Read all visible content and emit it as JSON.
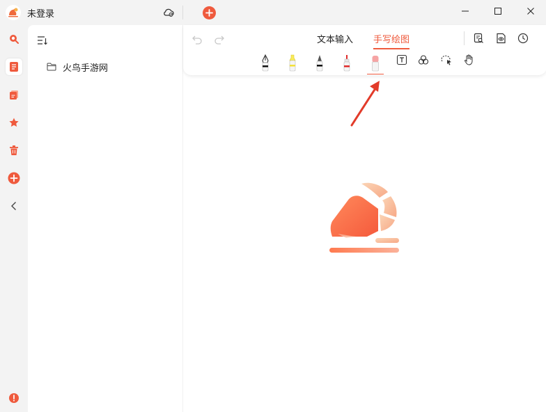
{
  "titlebar": {
    "user_label": "未登录"
  },
  "sidebar": {
    "folders": [
      {
        "label": "火鸟手游网"
      }
    ]
  },
  "editor": {
    "modes": [
      {
        "label": "文本输入",
        "active": false
      },
      {
        "label": "手写绘图",
        "active": true
      }
    ],
    "selected_tool": "eraser"
  },
  "colors": {
    "accent": "#ef5a3d",
    "rail_bg": "#f3f3f3",
    "panel_bg": "#ffffff"
  },
  "icons": [
    "app-logo-icon",
    "cloud-sync-icon",
    "add-tab-icon",
    "minimize-icon",
    "maximize-icon",
    "close-icon",
    "search-icon",
    "notes-icon",
    "tags-icon",
    "star-icon",
    "trash-icon",
    "add-icon",
    "collapse-icon",
    "info-icon",
    "sort-icon",
    "folder-icon",
    "undo-icon",
    "redo-icon",
    "search-doc-icon",
    "preview-icon",
    "history-icon",
    "fountain-pen-icon",
    "highlighter-icon",
    "pencil-icon",
    "marker-icon",
    "eraser-icon",
    "text-box-icon",
    "shapes-icon",
    "lasso-select-icon",
    "hand-icon"
  ]
}
